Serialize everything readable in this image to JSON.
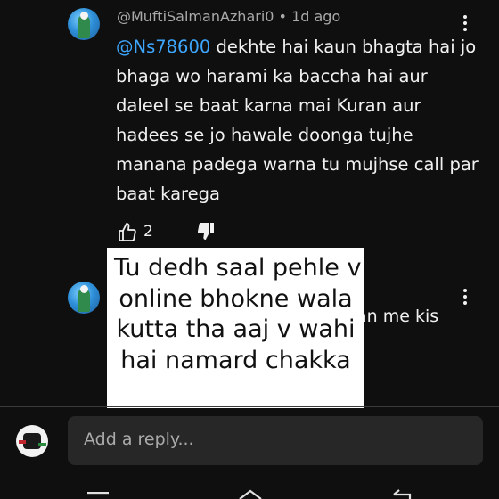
{
  "comment1": {
    "author": "@MuftiSalmanAzhari0",
    "separator": "•",
    "time": "1d ago",
    "mention": "@Ns78600",
    "text": " dekhte hai kaun bhagta hai jo bhaga wo harami ka baccha hai aur daleel se baat karna mai Kuran aur hadees se jo hawale doonga tujhe manana padega warna tu mujhse call par baat karega",
    "likes": "2",
    "like_icon": "thumbs-up-icon",
    "dislike_icon": "thumbs-down-icon",
    "menu_icon": "more-vert-icon"
  },
  "comment2": {
    "partial_text": "an me kis",
    "menu_icon": "more-vert-icon"
  },
  "overlay": {
    "lines": [
      "Tu dedh saal pehle v",
      "online bhokne wala",
      "kutta tha aaj v wahi",
      "hai namard chakka"
    ]
  },
  "reply": {
    "placeholder": "Add a reply..."
  },
  "navbar": {
    "icons": [
      "menu-icon",
      "home-icon",
      "back-icon"
    ]
  },
  "colors": {
    "background": "#0f0f0f",
    "mention": "#3ea6ff",
    "secondary_text": "#aaaaaa",
    "reply_box": "#272727"
  }
}
